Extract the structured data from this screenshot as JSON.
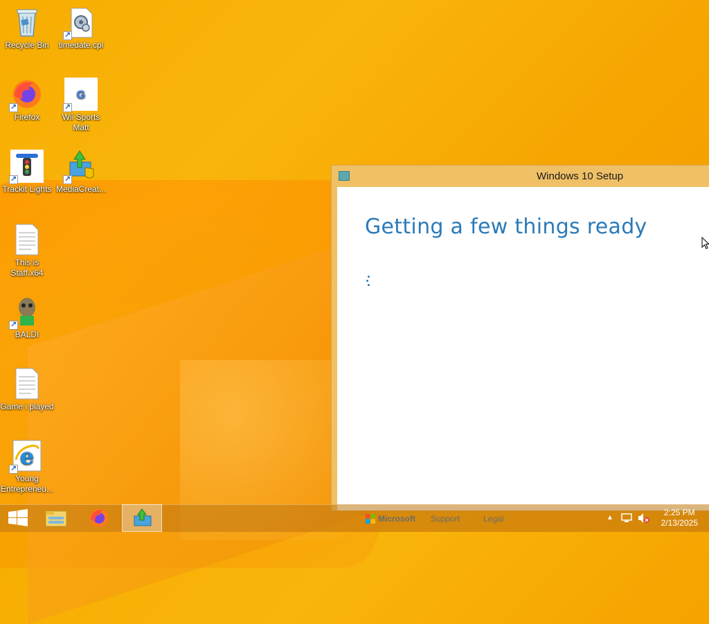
{
  "desktop": {
    "icons": [
      {
        "label": "Recycle Bin",
        "icon": "recycle-bin-icon"
      },
      {
        "label": "timedate.cpl",
        "icon": "control-panel-file-icon"
      },
      {
        "label": "Firefox",
        "icon": "firefox-icon"
      },
      {
        "label": "Wii Sports Matt",
        "icon": "google-icon"
      },
      {
        "label": "Trackit Lights",
        "icon": "traffic-light-icon"
      },
      {
        "label": "MediaCreat...",
        "icon": "media-creation-tool-icon"
      },
      {
        "label": "This is Staff.x64",
        "icon": "text-file-icon"
      },
      {
        "label": "BALDI",
        "icon": "baldi-icon"
      },
      {
        "label": "Game i played",
        "icon": "text-file-icon"
      },
      {
        "label": "Young Entrepreneu...",
        "icon": "internet-explorer-icon"
      }
    ]
  },
  "setup_window": {
    "title": "Windows 10 Setup",
    "heading": "Getting a few things ready",
    "footer": {
      "brand": "Microsoft",
      "links": [
        "Support",
        "Legal"
      ]
    }
  },
  "taskbar": {
    "buttons": [
      "start-icon",
      "file-explorer-icon",
      "firefox-icon",
      "media-creation-tool-icon"
    ],
    "active": "media-creation-tool-icon",
    "tray_icons": [
      "chevron-up-icon",
      "network-icon",
      "volume-muted-icon"
    ],
    "time": "2:25 PM",
    "date": "2/13/2025"
  },
  "colors": {
    "accent_blue": "#2a7ab9",
    "window_frame": "#efc066",
    "wallpaper": "#f7ad00"
  }
}
